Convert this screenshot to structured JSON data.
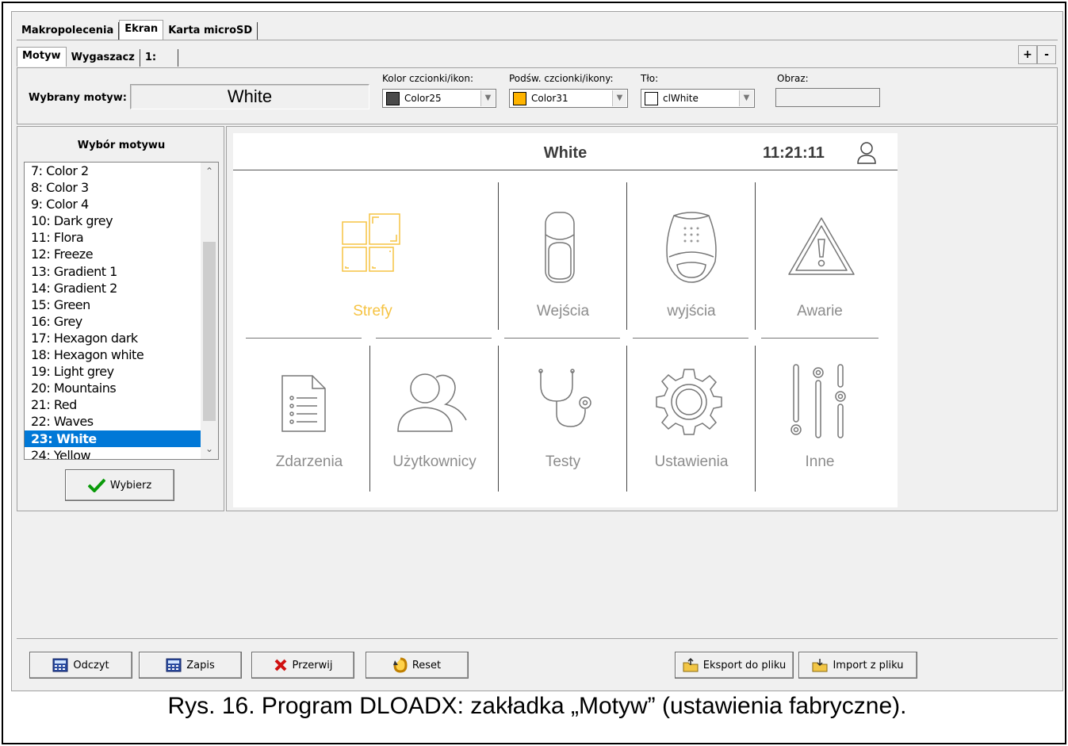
{
  "tabs_top": [
    "Makropolecenia",
    "Ekran",
    "Karta microSD"
  ],
  "tabs_second": [
    "Motyw",
    "Wygaszacz",
    "1:"
  ],
  "plus_label": "+",
  "minus_label": "-",
  "header": {
    "selected_theme_label": "Wybrany motyw:",
    "selected_theme_value": "White",
    "font_color_label": "Kolor czcionki/ikon:",
    "font_color_value": "Color25",
    "font_color_swatch": "#4a4a4a",
    "highlight_label": "Podśw. czcionki/ikony:",
    "highlight_value": "Color31",
    "highlight_swatch": "#ffb400",
    "background_label": "Tło:",
    "background_value": "clWhite",
    "background_swatch": "#ffffff",
    "image_label": "Obraz:"
  },
  "theme_panel": {
    "title": "Wybór motywu",
    "items": [
      "7: Color 2",
      "8: Color 3",
      "9: Color 4",
      "10: Dark grey",
      "11: Flora",
      "12: Freeze",
      "13: Gradient 1",
      "14: Gradient 2",
      "15: Green",
      "16: Grey",
      "17: Hexagon dark",
      "18: Hexagon white",
      "19: Light grey",
      "20: Mountains",
      "21: Red",
      "22: Waves",
      "23: White",
      "24: Yellow"
    ],
    "selected_index": 16,
    "select_button": "Wybierz"
  },
  "preview": {
    "title": "White",
    "time": "11:21:11",
    "accent_color": "#f6c342",
    "tiles_row1": [
      "Strefy",
      "Wejścia",
      "wyjścia",
      "Awarie"
    ],
    "tiles_row2": [
      "Zdarzenia",
      "Użytkownicy",
      "Testy",
      "Ustawienia",
      "Inne"
    ]
  },
  "bottom_buttons": {
    "read": "Odczyt",
    "write": "Zapis",
    "stop": "Przerwij",
    "reset": "Reset",
    "export": "Eksport do pliku",
    "import": "Import z pliku"
  },
  "caption": "Rys. 16. Program DLOADX: zakładka „Motyw” (ustawienia fabryczne)."
}
